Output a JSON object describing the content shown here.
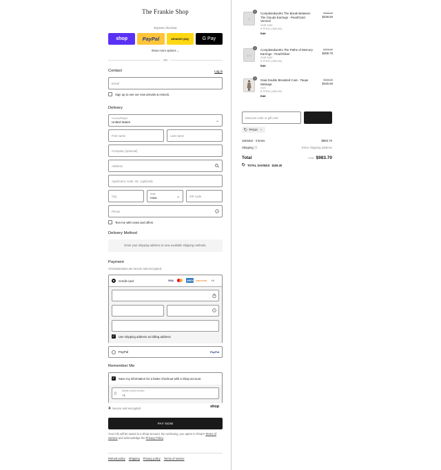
{
  "shop_name": "The Frankie Shop",
  "express": {
    "label": "Express checkout",
    "buttons": [
      "shop",
      "PayPal",
      "amazon pay",
      "G Pay"
    ],
    "more_options": "Show more options ⌄",
    "or": "OR"
  },
  "contact": {
    "heading": "Contact",
    "login": "Log in",
    "email_placeholder": "Email",
    "news_label": "Sign up to see our new arrivals & restock."
  },
  "delivery": {
    "heading": "Delivery",
    "country_label": "Country/Region",
    "country_value": "United States",
    "first_name": "First name",
    "last_name": "Last name",
    "company": "Company (optional)",
    "address": "Address",
    "apartment": "Apartment, suite, etc. (optional)",
    "city": "City",
    "state_label": "State",
    "state_value": "Iowa",
    "zip": "ZIP code",
    "phone": "Phone",
    "text_label": "Text me with news and offers"
  },
  "delivery_method": {
    "heading": "Delivery Method",
    "info": "Enter your shipping address to view available shipping methods."
  },
  "payment": {
    "heading": "Payment",
    "subtext": "All transactions are secure and encrypted.",
    "credit_card": "Credit card",
    "card_brands": [
      "VISA",
      "MC",
      "AMEX",
      "DISCOVER",
      "+4"
    ],
    "billing_label": "Use shipping address as billing address",
    "paypal": "PayPal",
    "paypal_logo": "PayPal"
  },
  "remember": {
    "heading": "Remember Me",
    "save_label": "Save my information for a faster checkout with a Shop account",
    "mobile_label": "Mobile phone number",
    "mobile_prefix": "+1",
    "secure": "Secure and encrypted",
    "shop_logo": "shop"
  },
  "pay_now": "PAY NOW",
  "legal": {
    "text_before": "Your info will be saved to a Shop account. By continuing, you agree to Shop's",
    "terms": "Terms of Service",
    "middle": "and acknowledge the",
    "privacy": "Privacy Policy",
    "end": "."
  },
  "footer_links": [
    "Refund policy",
    "Shipping",
    "Privacy policy",
    "Terms of service"
  ],
  "order": {
    "items": [
      {
        "qty": "1",
        "name": "Completedworks The Break Between The Clouds Earrings - Pearl/Gold Vermeil",
        "variant": "ONE SIZE",
        "discount": "TFS10 (-$26.50)",
        "edit": "Edit",
        "price_old": "$265.00",
        "price_new": "$238.50"
      },
      {
        "qty": "1",
        "name": "Completedworks The Paths of Memory Earrings - Pearl/Silver",
        "variant": "ONE SIZE",
        "discount": "TFS10 (-$33.30)",
        "edit": "Edit",
        "price_old": "$333.00",
        "price_new": "$299.70"
      },
      {
        "qty": "1",
        "name": "Gaia Double Breasted Coat - Taupe Melange",
        "variant": "XXS",
        "discount": "TFS10 (-$49.50)",
        "edit": "Edit",
        "price_old": "$495.00",
        "price_new": "$445.50"
      }
    ],
    "discount_placeholder": "Discount code or gift card",
    "applied_code": "TFS10",
    "subtotal_label": "Subtotal · 3 items",
    "subtotal_value": "$983.70",
    "shipping_label": "Shipping",
    "shipping_value": "Enter shipping address",
    "total_label": "Total",
    "total_currency": "USD",
    "total_value": "$983.70",
    "savings_label": "TOTAL SAVINGS",
    "savings_value": "$109.30"
  }
}
